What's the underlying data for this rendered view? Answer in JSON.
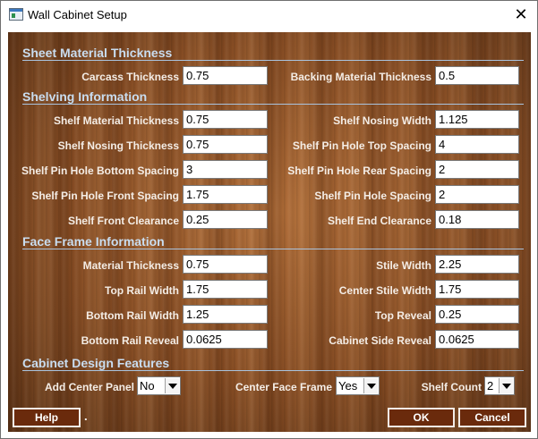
{
  "window": {
    "title": "Wall Cabinet Setup",
    "close_glyph": "✕"
  },
  "sheet": {
    "heading": "Sheet Material Thickness",
    "carcass_label": "Carcass Thickness",
    "carcass_value": "0.75",
    "backing_label": "Backing Material Thickness",
    "backing_value": "0.5"
  },
  "shelving": {
    "heading": "Shelving Information",
    "material_label": "Shelf Material Thickness",
    "material_value": "0.75",
    "nosing_width_label": "Shelf Nosing Width",
    "nosing_width_value": "1.125",
    "nosing_thickness_label": "Shelf Nosing Thickness",
    "nosing_thickness_value": "0.75",
    "pin_top_label": "Shelf Pin Hole Top Spacing",
    "pin_top_value": "4",
    "pin_bottom_label": "Shelf Pin Hole Bottom Spacing",
    "pin_bottom_value": "3",
    "pin_rear_label": "Shelf Pin Hole Rear Spacing",
    "pin_rear_value": "2",
    "pin_front_label": "Shelf Pin Hole Front Spacing",
    "pin_front_value": "1.75",
    "pin_spacing_label": "Shelf Pin Hole Spacing",
    "pin_spacing_value": "2",
    "front_clearance_label": "Shelf Front Clearance",
    "front_clearance_value": "0.25",
    "end_clearance_label": "Shelf End Clearance",
    "end_clearance_value": "0.18"
  },
  "face_frame": {
    "heading": "Face Frame Information",
    "material_label": "Material Thickness",
    "material_value": "0.75",
    "stile_width_label": "Stile Width",
    "stile_width_value": "2.25",
    "top_rail_label": "Top Rail Width",
    "top_rail_value": "1.75",
    "center_stile_label": "Center Stile Width",
    "center_stile_value": "1.75",
    "bottom_rail_label": "Bottom Rail Width",
    "bottom_rail_value": "1.25",
    "top_reveal_label": "Top Reveal",
    "top_reveal_value": "0.25",
    "bottom_rail_reveal_label": "Bottom Rail Reveal",
    "bottom_rail_reveal_value": "0.0625",
    "side_reveal_label": "Cabinet Side Reveal",
    "side_reveal_value": "0.0625"
  },
  "design": {
    "heading": "Cabinet Design Features",
    "center_panel_label": "Add Center Panel",
    "center_panel_value": "No",
    "center_frame_label": "Center Face Frame",
    "center_frame_value": "Yes",
    "shelf_count_label": "Shelf Count",
    "shelf_count_value": "2"
  },
  "buttons": {
    "help": "Help",
    "dot": ".",
    "ok": "OK",
    "cancel": "Cancel"
  }
}
